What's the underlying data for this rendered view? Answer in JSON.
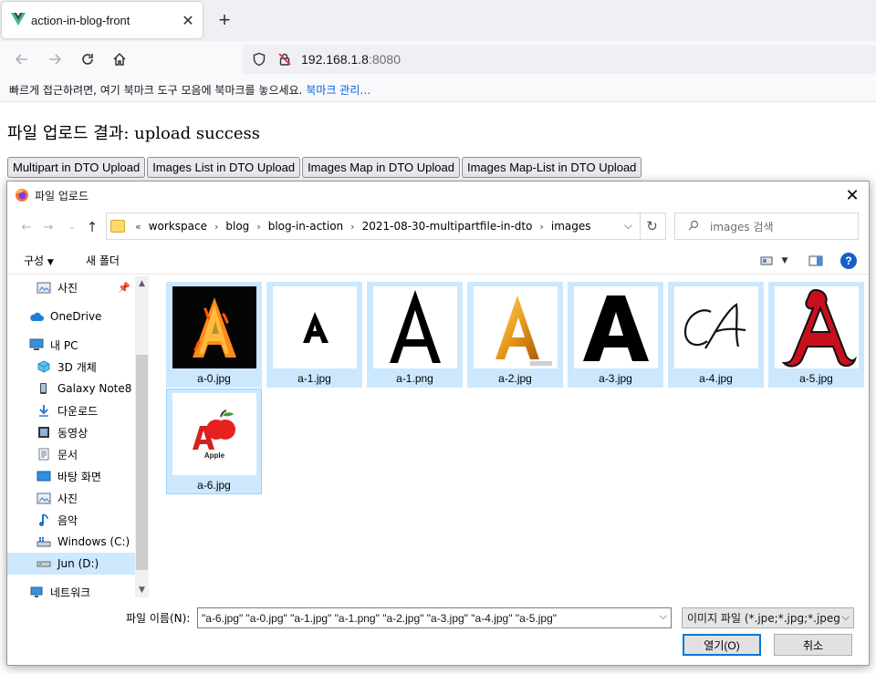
{
  "browser": {
    "tab_title": "action-in-blog-front",
    "url_host": "192.168.1.8",
    "url_port": ":8080",
    "bookmark_hint": "빠르게 접근하려면, 여기 북마크 도구 모음에 북마크를 놓으세요.",
    "bookmark_manage": "북마크 관리…"
  },
  "page": {
    "result_title": "파일 업로드 결과: upload success",
    "buttons": [
      "Multipart in DTO Upload",
      "Images List in DTO Upload",
      "Images Map in DTO Upload",
      "Images Map-List in DTO Upload"
    ]
  },
  "dialog": {
    "title": "파일 업로드",
    "breadcrumb": [
      "workspace",
      "blog",
      "blog-in-action",
      "2021-08-30-multipartfile-in-dto",
      "images"
    ],
    "breadcrumb_prefix": "«",
    "search_placeholder": "images 검색",
    "toolbar": {
      "organize": "구성",
      "new_folder": "새 폴더"
    },
    "nav": [
      {
        "label": "사진",
        "icon": "pictures-icon"
      },
      {
        "label": "OneDrive",
        "icon": "cloud-icon"
      },
      {
        "label": "내 PC",
        "icon": "pc-icon"
      },
      {
        "label": "3D 개체",
        "icon": "cube-icon"
      },
      {
        "label": "Galaxy Note8",
        "icon": "phone-icon"
      },
      {
        "label": "다운로드",
        "icon": "download-icon"
      },
      {
        "label": "동영상",
        "icon": "video-icon"
      },
      {
        "label": "문서",
        "icon": "document-icon"
      },
      {
        "label": "바탕 화면",
        "icon": "desktop-icon"
      },
      {
        "label": "사진",
        "icon": "pictures-icon"
      },
      {
        "label": "음악",
        "icon": "music-icon"
      },
      {
        "label": "Windows (C:)",
        "icon": "drive-icon"
      },
      {
        "label": "Jun (D:)",
        "icon": "drive-icon"
      },
      {
        "label": "네트워크",
        "icon": "network-icon"
      }
    ],
    "files": [
      "a-0.jpg",
      "a-1.jpg",
      "a-1.png",
      "a-2.jpg",
      "a-3.jpg",
      "a-4.jpg",
      "a-5.jpg",
      "a-6.jpg"
    ],
    "thumb_text": {
      "apple_caption": "Apple"
    },
    "filename_label": "파일 이름(N):",
    "filename_value": "\"a-6.jpg\" \"a-0.jpg\" \"a-1.jpg\" \"a-1.png\" \"a-2.jpg\" \"a-3.jpg\" \"a-4.jpg\" \"a-5.jpg\"",
    "filetype": "이미지 파일 (*.jpe;*.jpg;*.jpeg;*",
    "open_button": "열기(O)",
    "cancel_button": "취소"
  },
  "colors": {
    "selection": "#cce8ff",
    "accent": "#0078d7",
    "link": "#0061e0"
  }
}
